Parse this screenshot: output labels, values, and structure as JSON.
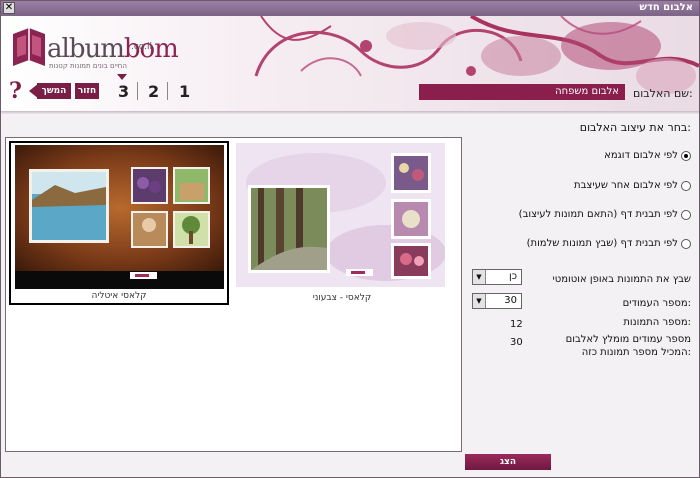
{
  "titlebar": {
    "title": "אלבום חדש",
    "close": "✕"
  },
  "logo": {
    "word_a": "album",
    "word_b": "bom",
    "tld": ".co.il",
    "slogan": "החיים בונים תמונות קטנות"
  },
  "steps": {
    "help": "?",
    "next_label": "המשך",
    "back_label": "חזור",
    "items": [
      "3",
      "2",
      "1"
    ],
    "current": "3"
  },
  "album_name": {
    "label": "שם האלבום:",
    "value": "אלבום משפחה"
  },
  "design": {
    "title": "בחר את עיצוב האלבום:",
    "options": [
      {
        "label": "לפי אלבום דוגמא",
        "selected": true
      },
      {
        "label": "לפי אלבום אחר שעיצבת",
        "selected": false
      },
      {
        "label": "לפי תבנית דף (התאם תמונות לעיצוב)",
        "selected": false
      },
      {
        "label": "לפי תבנית דף (שבץ תמונות שלמות)",
        "selected": false
      }
    ]
  },
  "auto_place": {
    "label": "שבץ את התמונות באופן אוטומטי",
    "value": "כן"
  },
  "pages": {
    "label": "מספר העמודים:",
    "value": "30"
  },
  "photos": {
    "label": "מספר התמונות:",
    "value": "12"
  },
  "recommended": {
    "label_line1": "מספר עמודים מומלץ לאלבום",
    "label_line2": "המכיל מספר תמונות כזה:",
    "value": "30"
  },
  "templates": [
    {
      "caption": "קלאסי איטליה",
      "selected": true
    },
    {
      "caption": "קלאסי - צבעוני",
      "selected": false
    }
  ],
  "show_button": "הצג",
  "colors": {
    "accent": "#7a1e46",
    "input_bg": "#8a1f4e"
  }
}
